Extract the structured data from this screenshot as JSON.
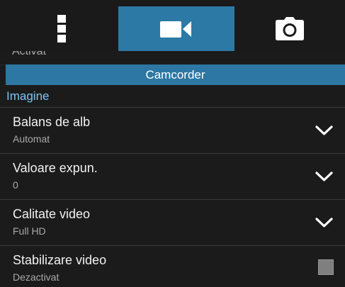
{
  "tabs": [
    {
      "icon": "more-vertical-icon"
    },
    {
      "icon": "video-camera-icon",
      "selected": true
    },
    {
      "icon": "camera-icon"
    }
  ],
  "peek_row": {
    "text": "Activat"
  },
  "section": {
    "title": "Camcorder"
  },
  "category": {
    "label": "Imagine"
  },
  "settings": [
    {
      "title": "Balans de alb",
      "value": "Automat",
      "control": "dropdown"
    },
    {
      "title": "Valoare expun.",
      "value": "0",
      "control": "dropdown"
    },
    {
      "title": "Calitate video",
      "value": "Full HD",
      "control": "dropdown"
    },
    {
      "title": "Stabilizare video",
      "value": "Dezactivat",
      "control": "checkbox",
      "checked": false
    }
  ],
  "colors": {
    "background": "#1b1b1c",
    "accent": "#2c77a3",
    "category_text": "#7fc6ef",
    "checkbox": "#7f7f80"
  }
}
